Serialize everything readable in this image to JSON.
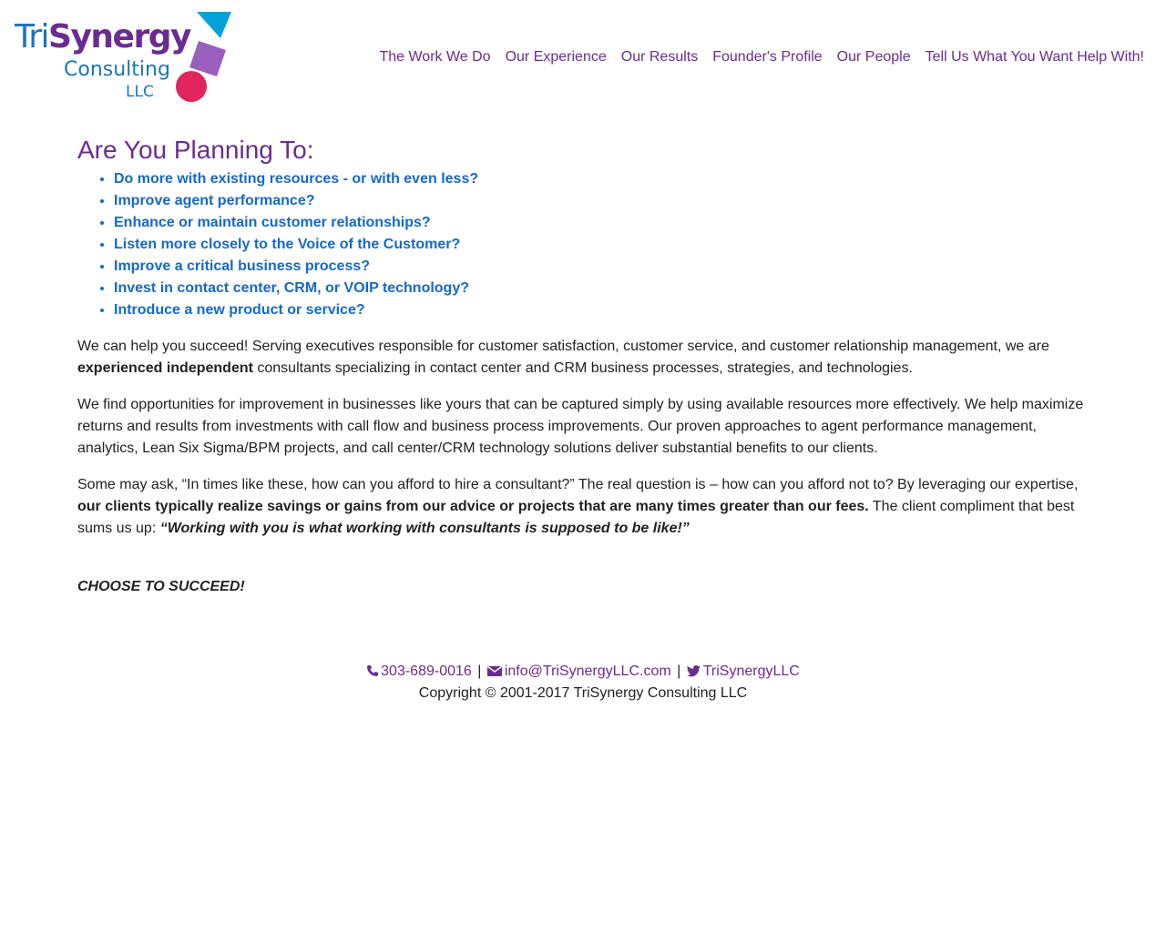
{
  "header": {
    "logo": {
      "name_part1": "Tri",
      "name_part2": "Synergy",
      "line2": "Consulting",
      "line3": "LLC",
      "colors": {
        "blue": "#1c75bc",
        "purple": "#6a2c91",
        "cyan": "#00a3d9",
        "magenta": "#e0245e",
        "lavender": "#9b5fc0"
      }
    },
    "nav": [
      {
        "label": "The Work We Do"
      },
      {
        "label": "Our Experience"
      },
      {
        "label": "Our Results"
      },
      {
        "label": "Founder's Profile"
      },
      {
        "label": "Our People"
      },
      {
        "label": "Tell Us What You Want Help With!"
      }
    ]
  },
  "main": {
    "heading": "Are You Planning To:",
    "bullets": [
      "Do more with existing resources - or with even less?",
      "Improve agent performance?",
      "Enhance or maintain customer relationships?",
      "Listen more closely to the Voice of the Customer?",
      "Improve a critical business process?",
      "Invest in contact center, CRM, or VOIP technology?",
      "Introduce a new product or service?"
    ],
    "p1": {
      "text1": "We can help you succeed! Serving executives responsible for customer satisfaction, customer service, and customer relationship management, we are ",
      "bold": "experienced independent",
      "text2": " consultants specializing in contact center and CRM business processes, strategies, and technologies."
    },
    "p2": "We find opportunities for improvement in businesses like yours that can be captured simply by using available resources more effectively. We help maximize returns and results from investments with call flow and business process improvements. Our proven approaches to agent performance management, analytics, Lean Six Sigma/BPM projects, and call center/CRM technology solutions deliver substantial benefits to our clients.",
    "p3": {
      "text1": "Some may ask, “In times like these, how can you afford to hire a consultant?” The real question is – how can you afford not to? By leveraging our expertise, ",
      "bold": "our clients typically realize savings or gains from our advice or projects that are many times greater than our fees.",
      "text2": " The client compliment that best sums us up: ",
      "quote": "“Working with you is what working with consultants is supposed to be like!”"
    },
    "closing": "CHOOSE TO SUCCEED!"
  },
  "footer": {
    "phone": "303-689-0016",
    "email": "info@TriSynergyLLC.com",
    "twitter": "TriSynergyLLC",
    "separator": "|",
    "copyright": "Copyright © 2001-2017 TriSynergy Consulting LLC",
    "icons": {
      "phone": "phone-icon",
      "email": "envelope-icon",
      "twitter": "twitter-icon"
    }
  }
}
